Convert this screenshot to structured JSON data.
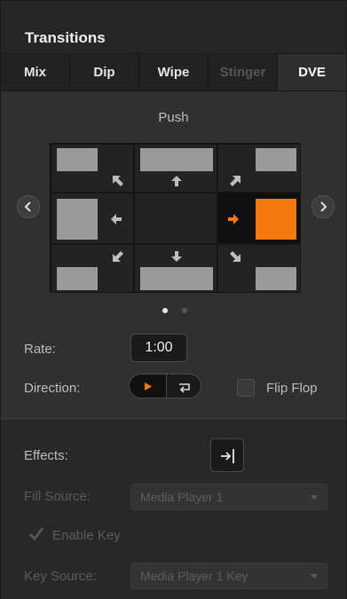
{
  "panel": {
    "title": "Transitions"
  },
  "tabs": [
    {
      "label": "Mix",
      "state": "normal"
    },
    {
      "label": "Dip",
      "state": "normal"
    },
    {
      "label": "Wipe",
      "state": "normal"
    },
    {
      "label": "Stinger",
      "state": "disabled"
    },
    {
      "label": "DVE",
      "state": "active"
    }
  ],
  "dve": {
    "style_name": "Push",
    "selected_direction": "right",
    "page_count": 2,
    "current_page": 1
  },
  "rate": {
    "label": "Rate:",
    "value": "1:00"
  },
  "direction": {
    "label": "Direction:",
    "options": [
      "normal",
      "reverse"
    ],
    "selected": "normal"
  },
  "flip_flop": {
    "label": "Flip Flop",
    "checked": false
  },
  "effects": {
    "label": "Effects:",
    "icon": "apply-effects-icon"
  },
  "fill_source": {
    "label": "Fill Source:",
    "value": "Media Player 1",
    "enabled": false
  },
  "enable_key": {
    "label": "Enable Key",
    "checked": true,
    "enabled": false
  },
  "key_source": {
    "label": "Key Source:",
    "value": "Media Player 1 Key",
    "enabled": false
  },
  "colors": {
    "accent": "#f47a10",
    "panel_bg": "#303030",
    "tile": "#9a9a9a"
  }
}
